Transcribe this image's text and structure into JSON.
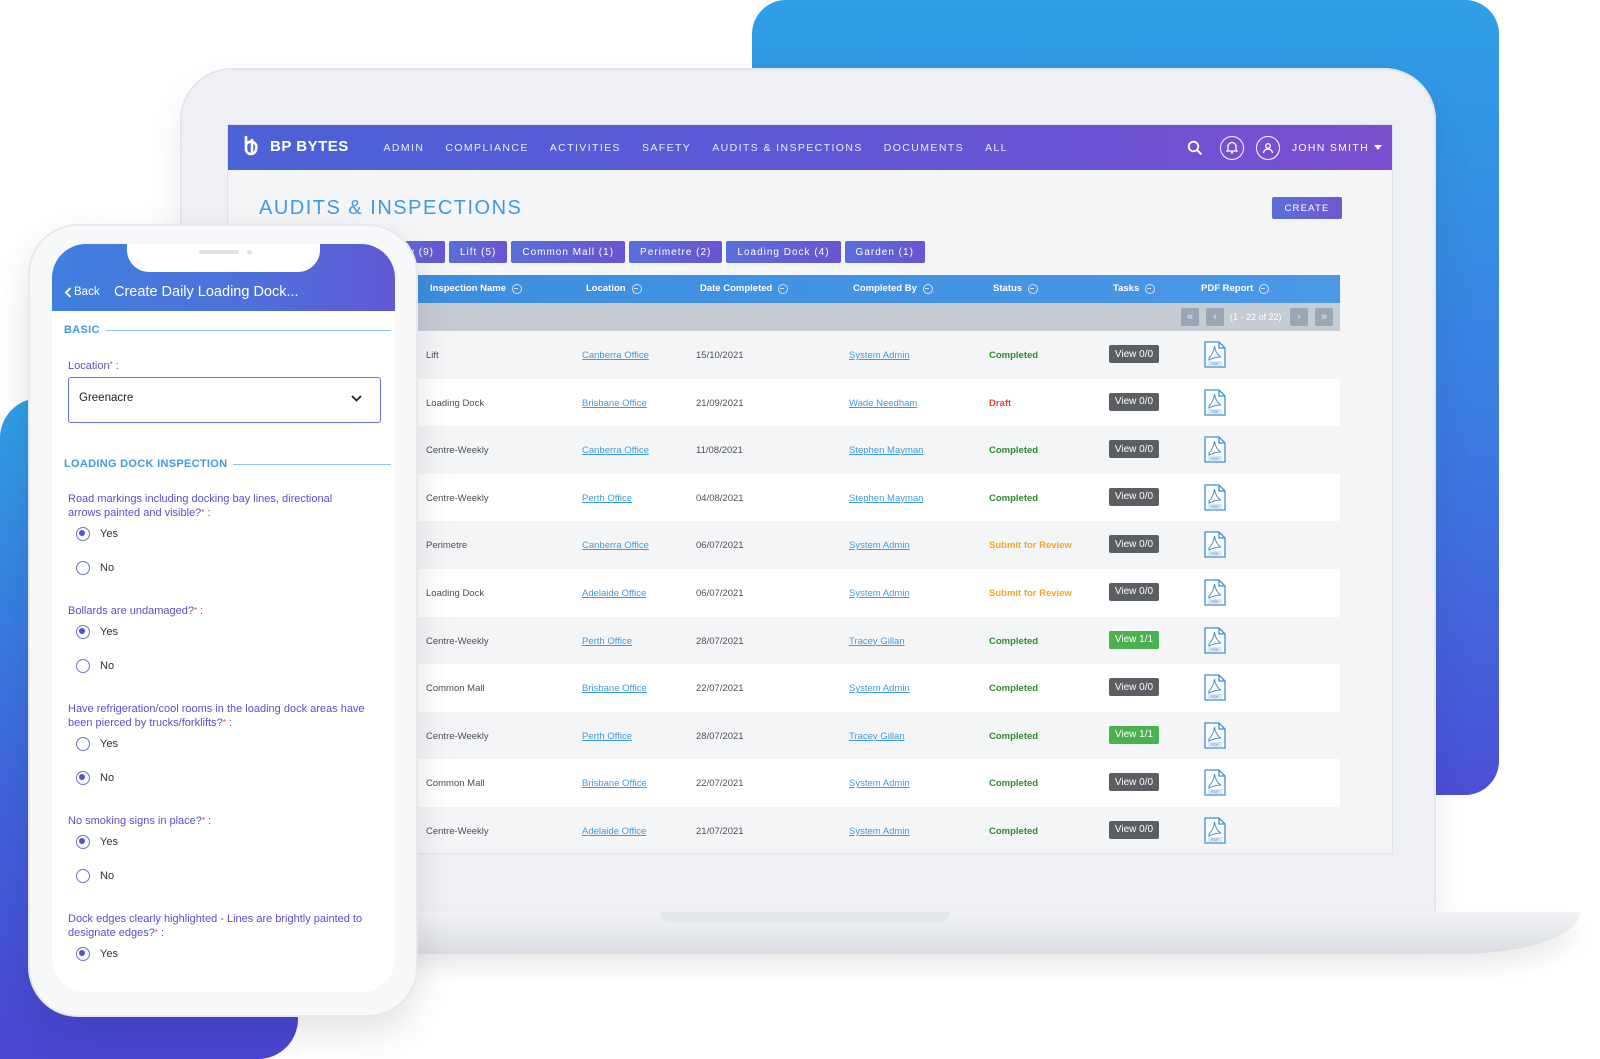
{
  "brand": {
    "name": "BP BYTES"
  },
  "nav": {
    "items": [
      "ADMIN",
      "COMPLIANCE",
      "ACTIVITIES",
      "SAFETY",
      "AUDITS & INSPECTIONS",
      "DOCUMENTS",
      "ALL"
    ],
    "user": "JOHN SMITH"
  },
  "page": {
    "title": "AUDITS & INSPECTIONS",
    "create_label": "CREATE"
  },
  "tabs": [
    "y (9)",
    "Lift (5)",
    "Common Mall (1)",
    "Perimetre (2)",
    "Loading Dock (4)",
    "Garden (1)"
  ],
  "table": {
    "headers": [
      "Inspection Name",
      "Location",
      "Date Completed",
      "Completed By",
      "Status",
      "Tasks",
      "PDF Report"
    ],
    "pager_label": "(1 - 22 of 22)",
    "rows": [
      {
        "name": "Lift",
        "location": "Canberra Office",
        "date": "15/10/2021",
        "by": "System Admin",
        "status": "Completed",
        "task": "View 0/0"
      },
      {
        "name": "Loading Dock",
        "location": "Brisbane Office",
        "date": "21/09/2021",
        "by": "Wade Needham",
        "status": "Draft",
        "task": "View 0/0"
      },
      {
        "name": "Centre-Weekly",
        "location": "Canberra Office",
        "date": "11/08/2021",
        "by": "Stephen Mayman",
        "status": "Completed",
        "task": "View 0/0"
      },
      {
        "name": "Centre-Weekly",
        "location": "Perth Office",
        "date": "04/08/2021",
        "by": "Stephen Mayman",
        "status": "Completed",
        "task": "View 0/0"
      },
      {
        "name": "Perimetre",
        "location": "Canberra Office",
        "date": "06/07/2021",
        "by": "System Admin",
        "status": "Submit for Review",
        "task": "View 0/0"
      },
      {
        "name": "Loading Dock",
        "location": "Adelaide Office",
        "date": "06/07/2021",
        "by": "System Admin",
        "status": "Submit for Review",
        "task": "View 0/0"
      },
      {
        "name": "Centre-Weekly",
        "location": "Perth Office",
        "date": "28/07/2021",
        "by": "Tracey Gillan",
        "status": "Completed",
        "task": "View 1/1"
      },
      {
        "name": "Common Mall",
        "location": "Brisbane Office",
        "date": "22/07/2021",
        "by": "System Admin",
        "status": "Completed",
        "task": "View 0/0"
      },
      {
        "name": "Centre-Weekly",
        "location": "Perth Office",
        "date": "28/07/2021",
        "by": "Tracey Gillan",
        "status": "Completed",
        "task": "View 1/1"
      },
      {
        "name": "Common Mall",
        "location": "Brisbane Office",
        "date": "22/07/2021",
        "by": "System Admin",
        "status": "Completed",
        "task": "View 0/0"
      },
      {
        "name": "Centre-Weekly",
        "location": "Adelaide Office",
        "date": "21/07/2021",
        "by": "System Admin",
        "status": "Completed",
        "task": "View 0/0"
      }
    ]
  },
  "phone": {
    "back_label": "Back",
    "title": "Create Daily Loading Dock...",
    "basic_section": "BASIC",
    "location_label": "Location",
    "location_value": "Greenacre",
    "inspection_section": "LOADING DOCK INSPECTION",
    "questions": [
      {
        "text": "Road markings including docking bay lines, directional arrows painted and visible?",
        "options": [
          "Yes",
          "No"
        ],
        "selected": "Yes"
      },
      {
        "text": "Bollards are undamaged?",
        "options": [
          "Yes",
          "No"
        ],
        "selected": "Yes"
      },
      {
        "text": "Have refrigeration/cool rooms in the loading dock areas have been pierced by trucks/forklifts?",
        "options": [
          "Yes",
          "No"
        ],
        "selected": "No"
      },
      {
        "text": "No smoking signs in place?",
        "options": [
          "Yes",
          "No"
        ],
        "selected": "Yes"
      },
      {
        "text": "Dock edges clearly highlighted - Lines are brightly painted to designate edges?",
        "options": [
          "Yes"
        ],
        "selected": "Yes"
      }
    ]
  },
  "colors": {
    "accent_blue": "#3f9be0",
    "nav_purple": "#6a54d0",
    "completed": "#2e8b2e",
    "draft": "#e0483c",
    "review": "#f5a623"
  },
  "icons": [
    "search-icon",
    "bell-icon",
    "user-icon",
    "chevron-down-icon",
    "pdf-icon",
    "sort-icon",
    "chevron-left-icon"
  ]
}
